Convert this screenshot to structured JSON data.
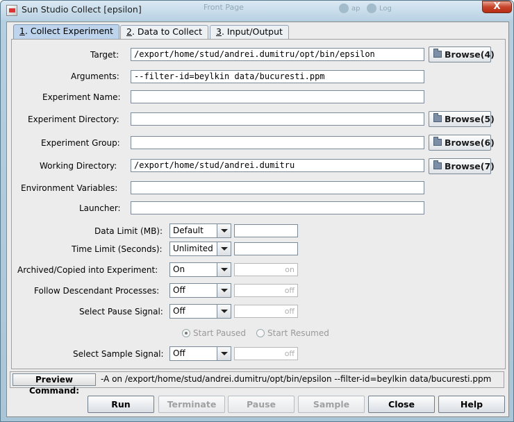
{
  "window": {
    "title": "Sun Studio Collect [epsilon]",
    "close": "X",
    "background_title": "Front Page",
    "background_b": "ap",
    "background_d": "Log"
  },
  "tabs": [
    {
      "num": "1",
      "label": ". Collect Experiment"
    },
    {
      "num": "2",
      "label": ". Data to Collect"
    },
    {
      "num": "3",
      "label": ". Input/Output"
    }
  ],
  "fields": {
    "target": {
      "label": "Target:",
      "value": "/export/home/stud/andrei.dumitru/opt/bin/epsilon",
      "browse": "Browse(4)"
    },
    "arguments": {
      "label": "Arguments:",
      "value": "--filter-id=beylkin data/bucuresti.ppm"
    },
    "experiment_name": {
      "label": "Experiment Name:",
      "value": ""
    },
    "experiment_directory": {
      "label": "Experiment Directory:",
      "value": "",
      "browse": "Browse(5)"
    },
    "experiment_group": {
      "label": "Experiment Group:",
      "value": "",
      "browse": "Browse(6)"
    },
    "working_directory": {
      "label": "Working Directory:",
      "value": "/export/home/stud/andrei.dumitru",
      "browse": "Browse(7)"
    },
    "environment_variables": {
      "label": "Environment Variables:",
      "value": ""
    },
    "launcher": {
      "label": "Launcher:",
      "value": ""
    }
  },
  "options": {
    "data_limit": {
      "label": "Data Limit (MB):",
      "value": "Default",
      "extra": ""
    },
    "time_limit": {
      "label": "Time Limit (Seconds):",
      "value": "Unlimited",
      "extra": ""
    },
    "archived": {
      "label": "Archived/Copied into Experiment:",
      "value": "On",
      "extra": "on"
    },
    "follow": {
      "label": "Follow Descendant Processes:",
      "value": "Off",
      "extra": "off"
    },
    "pause_signal": {
      "label": "Select Pause Signal:",
      "value": "Off",
      "extra": "off"
    },
    "sample_signal": {
      "label": "Select Sample Signal:",
      "value": "Off",
      "extra": "off"
    }
  },
  "radios": {
    "start_paused": "Start Paused",
    "start_resumed": "Start Resumed"
  },
  "preview": {
    "button": "Preview Command:",
    "text": "-A on /export/home/stud/andrei.dumitru/opt/bin/epsilon --filter-id=beylkin data/bucuresti.ppm"
  },
  "buttons": {
    "run": "Run",
    "terminate": "Terminate",
    "pause": "Pause",
    "sample": "Sample",
    "close": "Close",
    "help": "Help"
  },
  "colors": {
    "active_tab": "#bdd4ec",
    "title_close": "#c7442a"
  }
}
